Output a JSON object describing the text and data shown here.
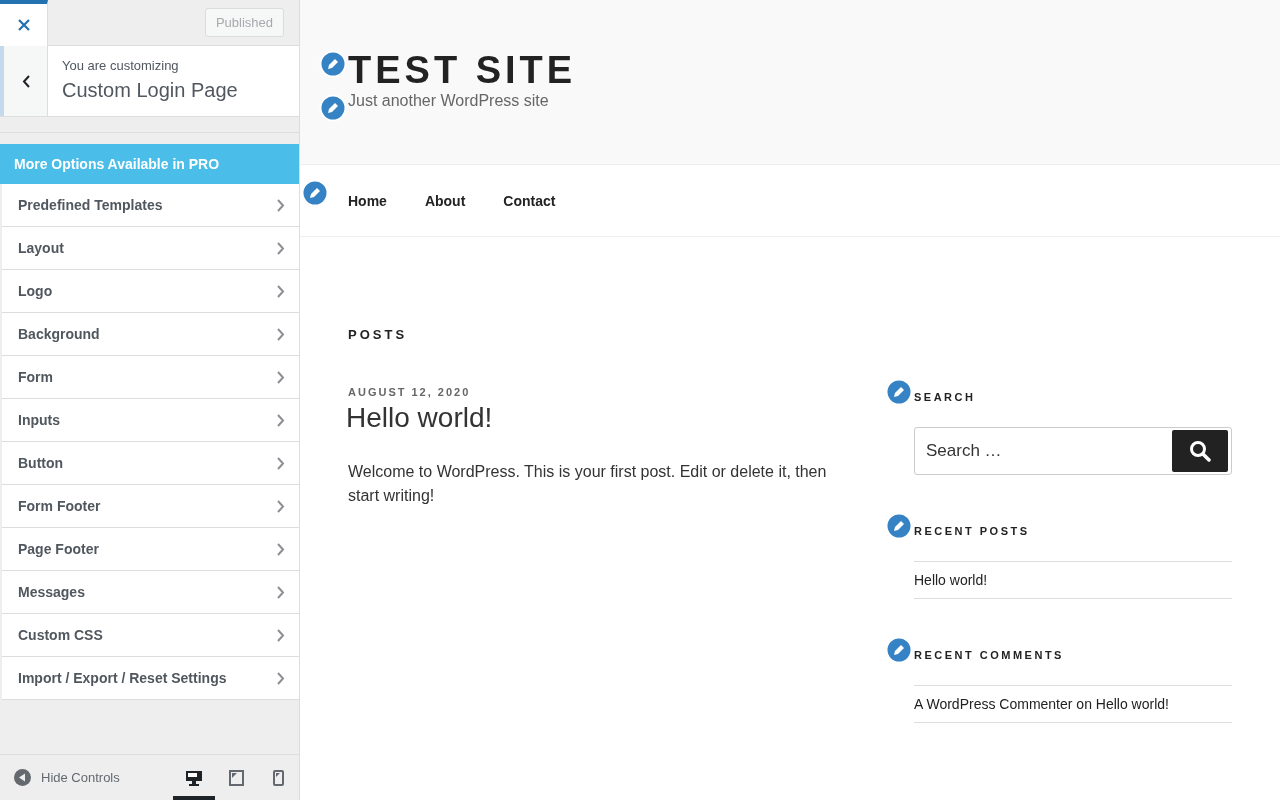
{
  "sidebar": {
    "publish_button": "Published",
    "customizing_label": "You are customizing",
    "customizing_title": "Custom Login Page",
    "pro_banner": "More Options Available in PRO",
    "sections": [
      "Predefined Templates",
      "Layout",
      "Logo",
      "Background",
      "Form",
      "Inputs",
      "Button",
      "Form Footer",
      "Page Footer",
      "Messages",
      "Custom CSS",
      "Import / Export / Reset Settings"
    ],
    "hide_controls": "Hide Controls",
    "devices": [
      {
        "kind": "desktop",
        "selected": true
      },
      {
        "kind": "tablet",
        "selected": false
      },
      {
        "kind": "mobile",
        "selected": false
      }
    ]
  },
  "site": {
    "title": "TEST SITE",
    "tagline": "Just another WordPress site",
    "menu": [
      "Home",
      "About",
      "Contact"
    ]
  },
  "posts": {
    "heading": "POSTS",
    "date": "AUGUST 12, 2020",
    "title": "Hello world!",
    "excerpt": "Welcome to WordPress. This is your first post. Edit or delete it, then start writing!"
  },
  "widgets": {
    "search": {
      "heading": "SEARCH",
      "placeholder": "Search …"
    },
    "recent_posts": {
      "heading": "RECENT POSTS",
      "items": [
        "Hello world!"
      ]
    },
    "recent_comments": {
      "heading": "RECENT COMMENTS",
      "items": [
        {
          "author": "A WordPress Commenter",
          "joiner": "on",
          "post": "Hello world!"
        }
      ]
    }
  }
}
